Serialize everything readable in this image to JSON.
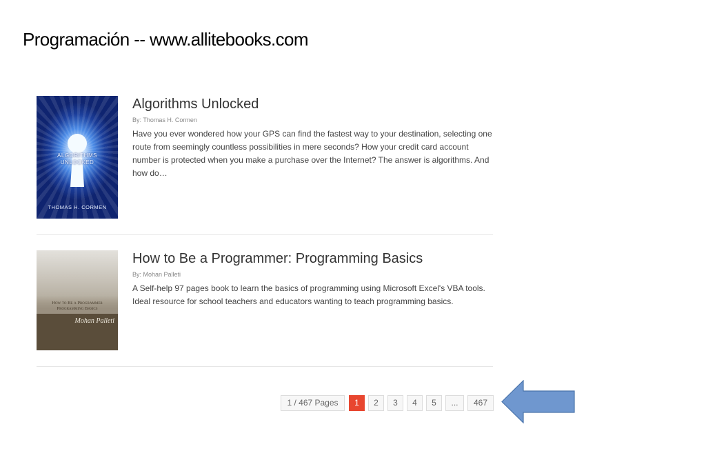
{
  "slide": {
    "title": "Programación -- www.allitebooks.com"
  },
  "books": [
    {
      "title": "Algorithms Unlocked",
      "byline": "By: Thomas H. Cormen",
      "description": "Have you ever wondered how your GPS can find the fastest way to your destination, selecting one route from seemingly countless possibilities in mere seconds? How your credit card account number is protected when you make a purchase over the Internet? The answer is algorithms. And how do…",
      "cover": {
        "line1": "ALGORITHMS",
        "line2": "UNLOCKED",
        "author": "THOMAS H. CORMEN"
      }
    },
    {
      "title": "How to Be a Programmer: Programming Basics",
      "byline": "By: Mohan Palleti",
      "description": "A Self-help 97 pages book to learn the basics of programming using Microsoft Excel's VBA tools. Ideal resource for school teachers and educators wanting to teach programming basics.",
      "cover": {
        "line1": "How to Be a Programmer",
        "line2": "Programming Basics",
        "author": "Mohan Palleti"
      }
    }
  ],
  "pagination": {
    "summary": "1 / 467 Pages",
    "pages": [
      "1",
      "2",
      "3",
      "4",
      "5",
      "...",
      "467"
    ],
    "current": "1"
  },
  "colors": {
    "accent": "#e8462f",
    "arrow_fill": "#6f97cf",
    "arrow_stroke": "#4a74ab"
  },
  "annotation": {
    "icon": "left-arrow-icon"
  }
}
